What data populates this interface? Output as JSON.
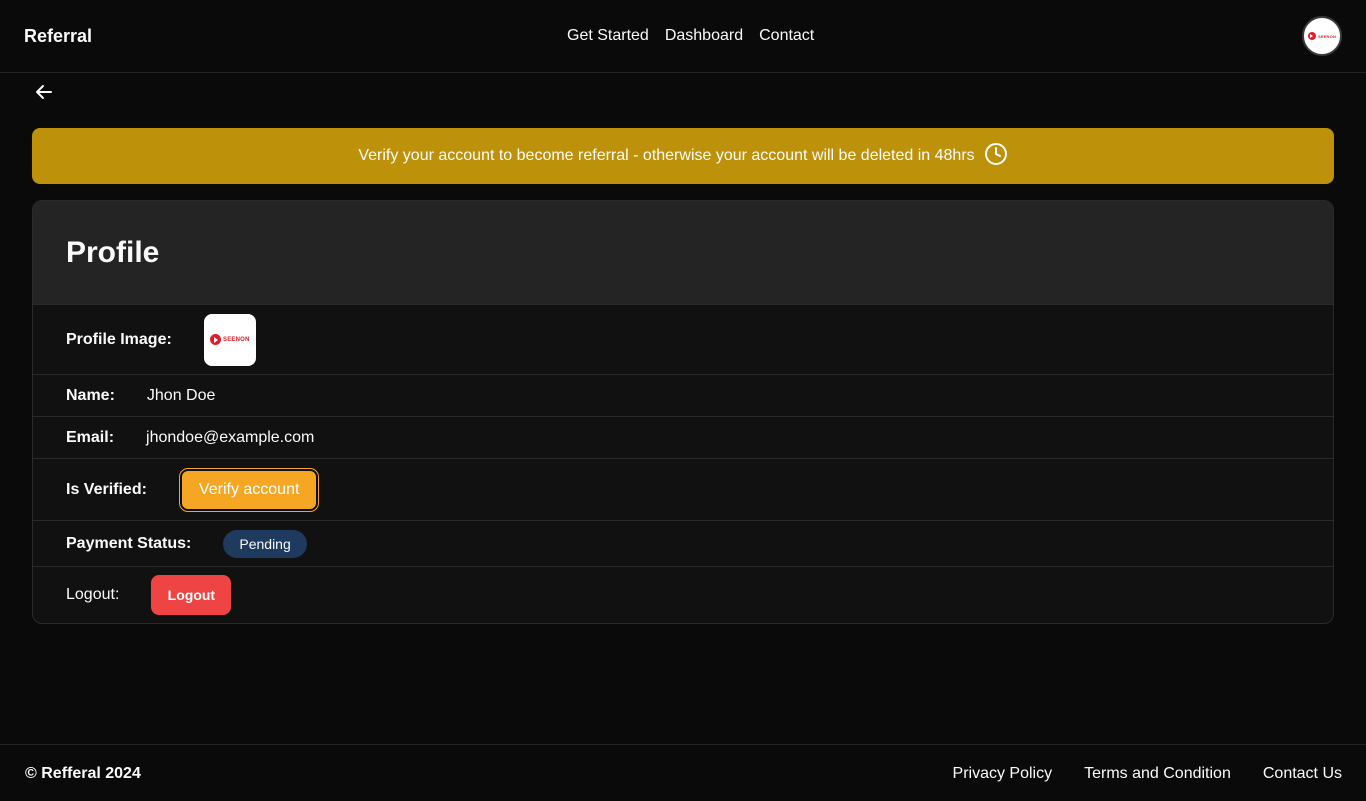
{
  "header": {
    "brand": "Referral",
    "nav": [
      "Get Started",
      "Dashboard",
      "Contact"
    ],
    "avatar_logo_text": "SEENON"
  },
  "banner": {
    "text": "Verify your account to become referral - otherwise your account will be deleted in 48hrs",
    "color": "#bd920a"
  },
  "profile": {
    "title": "Profile",
    "image_label": "Profile Image:",
    "image_logo_text": "SEENON",
    "name_label": "Name:",
    "name_value": "Jhon Doe",
    "email_label": "Email:",
    "email_value": "jhondoe@example.com",
    "verified_label": "Is Verified:",
    "verify_button": "Verify account",
    "payment_label": "Payment Status:",
    "payment_status": "Pending",
    "logout_label": "Logout:",
    "logout_button": "Logout"
  },
  "footer": {
    "copyright": "© Refferal 2024",
    "links": [
      "Privacy Policy",
      "Terms and Condition",
      "Contact Us"
    ]
  },
  "colors": {
    "background": "#0a0a0a",
    "banner": "#bd920a",
    "verify_button": "#f5a623",
    "pending_badge": "#1e3a5f",
    "logout_button": "#ef4444",
    "brand_red": "#e11d2a"
  }
}
